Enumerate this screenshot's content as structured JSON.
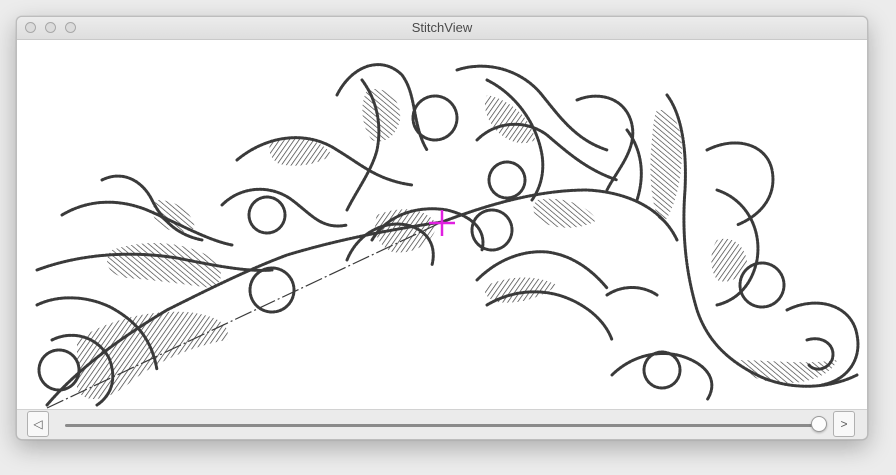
{
  "window": {
    "title": "StitchView"
  },
  "canvas": {
    "content": "embroidery-stitch-pattern",
    "stitch_color": "#3a3a3a",
    "needle_marker_color": "#e020e0"
  },
  "playback": {
    "prev_icon": "left-triangle-icon",
    "next_icon": "right-chevron-icon",
    "progress": 1.0
  }
}
